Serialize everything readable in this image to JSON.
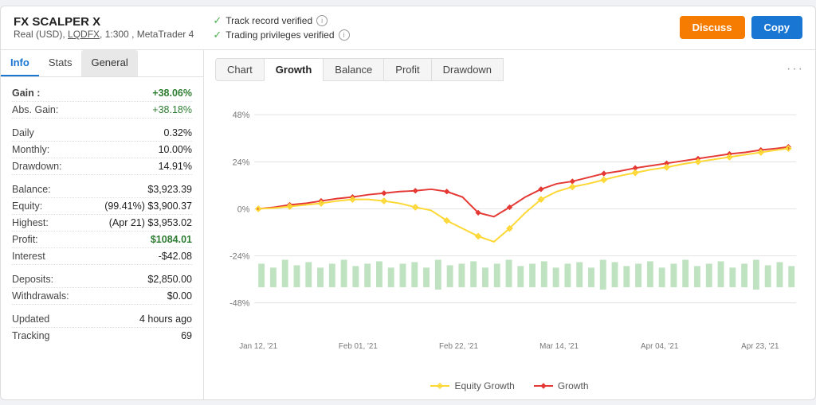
{
  "header": {
    "title": "FX SCALPER X",
    "subtitle_account": "Real (USD)",
    "subtitle_broker": "LQDFX",
    "subtitle_tf": "1:300",
    "subtitle_platform": "MetaTrader 4",
    "verified1": "Track record verified",
    "verified2": "Trading privileges verified",
    "btn_discuss": "Discuss",
    "btn_copy": "Copy"
  },
  "left_panel": {
    "tab_info": "Info",
    "tab_stats": "Stats",
    "tab_general": "General",
    "stats": [
      {
        "label": "Gain :",
        "value": "+38.06%",
        "style": "green bold"
      },
      {
        "label": "Abs. Gain:",
        "value": "+38.18%",
        "style": "green"
      },
      {
        "label": "Daily",
        "value": "0.32%",
        "style": ""
      },
      {
        "label": "Monthly:",
        "value": "10.00%",
        "style": ""
      },
      {
        "label": "Drawdown:",
        "value": "14.91%",
        "style": ""
      },
      {
        "label": "Balance:",
        "value": "$3,923.39",
        "style": ""
      },
      {
        "label": "Equity:",
        "value": "(99.41%) $3,900.37",
        "style": ""
      },
      {
        "label": "Highest:",
        "value": "(Apr 21) $3,953.02",
        "style": ""
      },
      {
        "label": "Profit:",
        "value": "$1084.01",
        "style": "green"
      },
      {
        "label": "Interest",
        "value": "-$42.08",
        "style": ""
      },
      {
        "label": "Deposits:",
        "value": "$2,850.00",
        "style": ""
      },
      {
        "label": "Withdrawals:",
        "value": "$0.00",
        "style": ""
      },
      {
        "label": "Updated",
        "value": "4 hours ago",
        "style": ""
      },
      {
        "label": "Tracking",
        "value": "69",
        "style": ""
      }
    ]
  },
  "chart_panel": {
    "tabs": [
      "Chart",
      "Growth",
      "Balance",
      "Profit",
      "Drawdown"
    ],
    "active_tab": "Growth",
    "legend": {
      "equity": "Equity Growth",
      "growth": "Growth"
    },
    "y_labels": [
      "48%",
      "24%",
      "0%",
      "-24%",
      "-48%"
    ],
    "x_labels": [
      "Jan 12, '21",
      "Feb 01, '21",
      "Feb 22, '21",
      "Mar 14, '21",
      "Apr 04, '21",
      "Apr 23, '21"
    ]
  }
}
